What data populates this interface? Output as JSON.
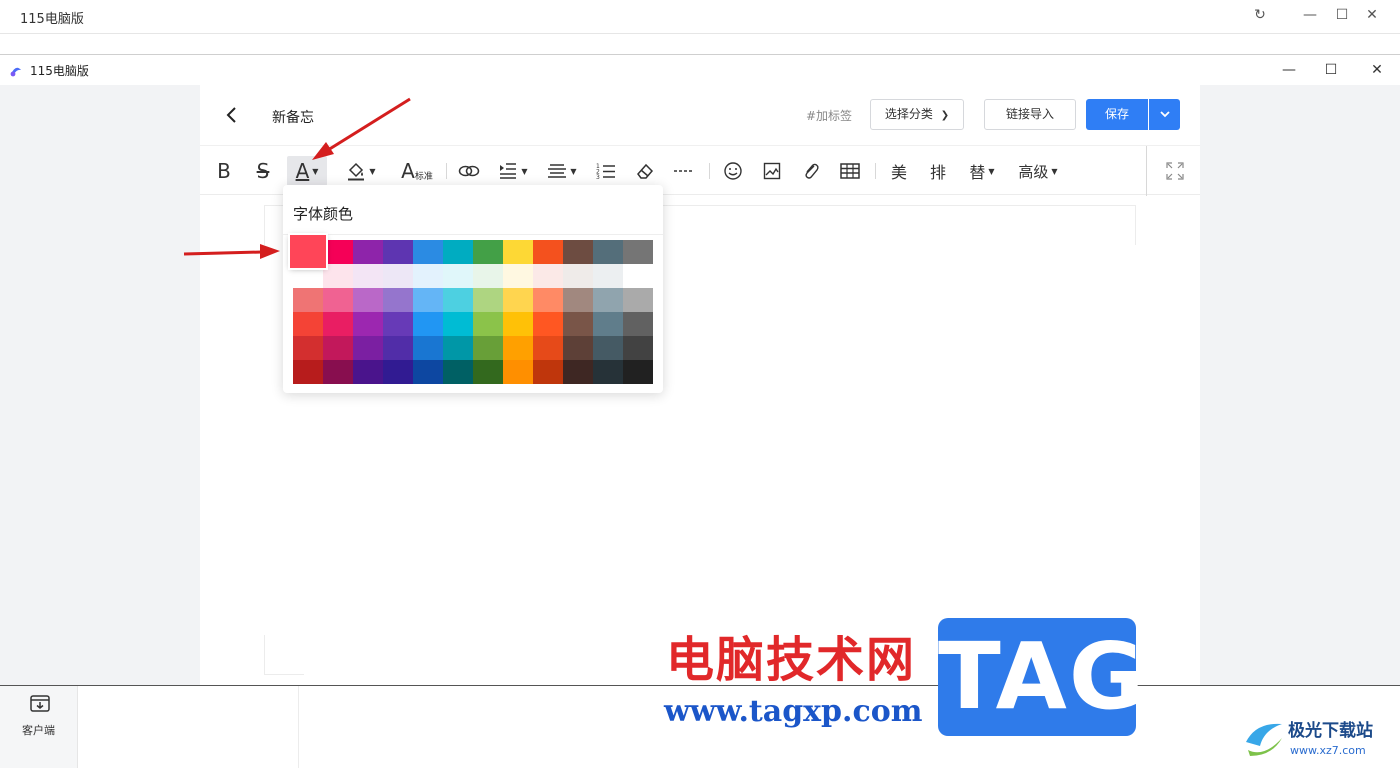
{
  "outer_window": {
    "title": "115电脑版"
  },
  "app_window": {
    "title": "115电脑版",
    "controls": [
      "—",
      "☐",
      "✕"
    ]
  },
  "editor": {
    "title": "新备忘",
    "tag_link": "#加标签",
    "category_button": "选择分类",
    "import_button": "链接导入",
    "save_button": "保存",
    "toolbar": {
      "bold": "B",
      "strike": "S",
      "font_color": "A",
      "font_size_label": "标准",
      "beautify": "美",
      "layout": "排",
      "replace": "替",
      "advanced": "高级"
    }
  },
  "color_picker": {
    "title": "字体颜色",
    "selected": "#ff4558",
    "rows": [
      [
        "#f50057",
        "#8e24aa",
        "#5e35b1",
        "#2b8be3",
        "#00acc1",
        "#43a047",
        "#fdd835",
        "#f4511e",
        "#6d4c41",
        "#546e7a",
        "#757575"
      ],
      [
        "#fde4ec",
        "#f3e5f5",
        "#ede7f6",
        "#e3f2fd",
        "#e0f7fa",
        "#e8f5e9",
        "#fff8e1",
        "#fbe9e7",
        "#efebe9",
        "#eceff1",
        "#ffffff"
      ],
      [
        "#ef7474",
        "#f06292",
        "#ba68c8",
        "#9575cd",
        "#64b5f6",
        "#4dd0e1",
        "#aed581",
        "#ffd54f",
        "#ff8a65",
        "#a1887f",
        "#90a4ae",
        "#aaaaaa"
      ],
      [
        "#f44336",
        "#e91e63",
        "#9c27b0",
        "#673ab7",
        "#2196f3",
        "#00bcd4",
        "#8bc34a",
        "#ffc107",
        "#ff5722",
        "#795548",
        "#607d8b",
        "#616161"
      ],
      [
        "#d32f2f",
        "#c2185b",
        "#7b1fa2",
        "#512da8",
        "#1976d2",
        "#0097a7",
        "#689f38",
        "#ffa000",
        "#e64a19",
        "#5d4037",
        "#455a64",
        "#424242"
      ],
      [
        "#b71c1c",
        "#880e4f",
        "#4a148c",
        "#311b92",
        "#0d47a1",
        "#006064",
        "#33691e",
        "#ff8f00",
        "#bf360c",
        "#3e2723",
        "#263238",
        "#212121"
      ]
    ]
  },
  "sidebar_bottom": {
    "client_label": "客户端"
  },
  "watermark": {
    "cn_text": "电脑技术网",
    "url": "www.tagxp.com",
    "tag": "TAG",
    "site_name": "极光下载站",
    "site_url": "www.xz7.com"
  }
}
